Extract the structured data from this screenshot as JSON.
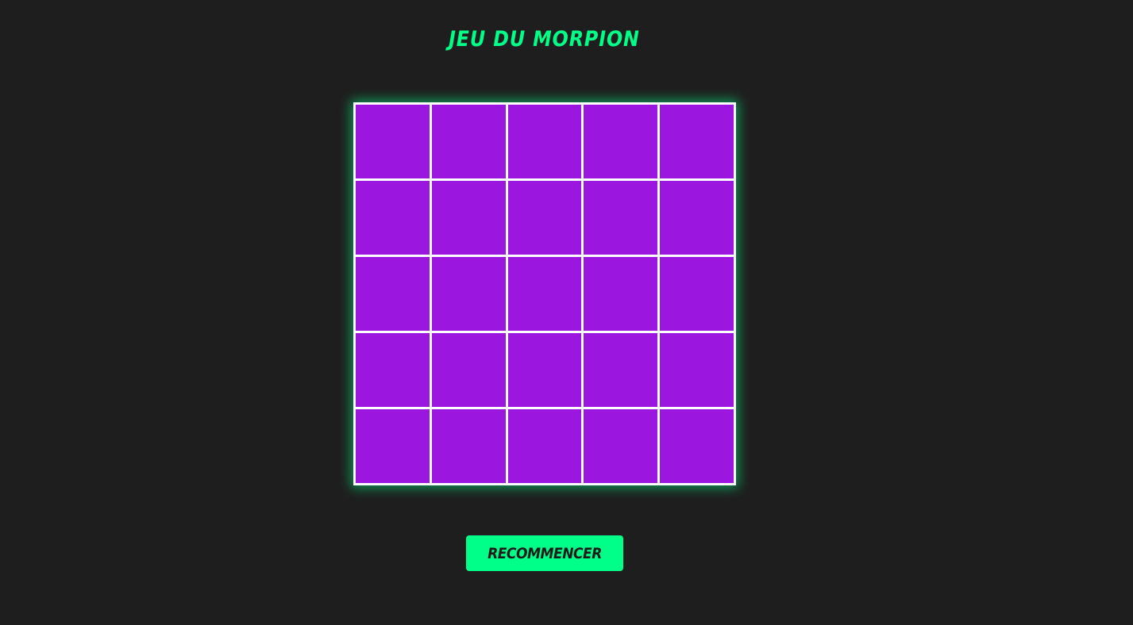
{
  "title": "JEU DU MORPION",
  "colors": {
    "background": "#1e1e1e",
    "accent": "#00ff88",
    "cell": "#9b16de",
    "grid_lines": "#ffffff"
  },
  "board": {
    "rows": 5,
    "cols": 5,
    "cells": [
      [
        "",
        "",
        "",
        "",
        ""
      ],
      [
        "",
        "",
        "",
        "",
        ""
      ],
      [
        "",
        "",
        "",
        "",
        ""
      ],
      [
        "",
        "",
        "",
        "",
        ""
      ],
      [
        "",
        "",
        "",
        "",
        ""
      ]
    ]
  },
  "restart_label": "RECOMMENCER"
}
